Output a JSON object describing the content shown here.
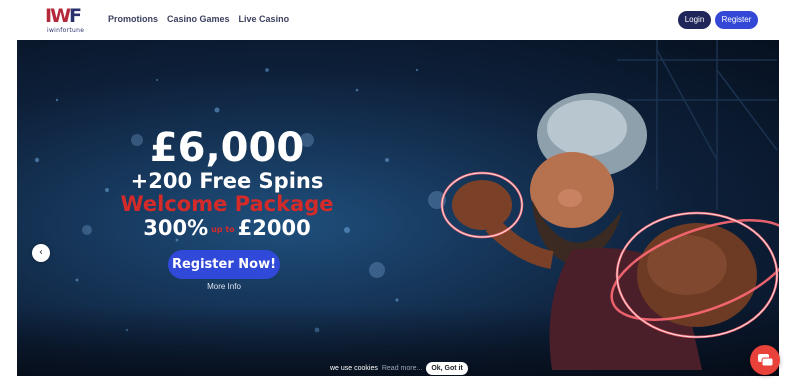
{
  "brand": {
    "logo_text_w": "IW",
    "logo_text_f": "F",
    "logo_subtitle": "iwinfortune"
  },
  "nav": {
    "items": [
      "Promotions",
      "Casino Games",
      "Live Casino"
    ]
  },
  "auth": {
    "login_label": "Login",
    "register_label": "Register"
  },
  "hero": {
    "amount": "£6,000",
    "free_spins": "+200 Free Spins",
    "package": "Welcome Package",
    "percent": "300%",
    "up_to": "up to",
    "max_bonus": "£2000",
    "cta_label": "Register Now!",
    "more_info": "More Info"
  },
  "carousel": {
    "prev_icon": "chevron-left-icon",
    "next_icon": "chevron-right-icon"
  },
  "cookie": {
    "text": "we use cookies",
    "link": "Read more...",
    "ok_label": "Ok, Got it"
  },
  "colors": {
    "accent": "#3149d8",
    "brand_red": "#b5283a",
    "brand_navy": "#202659",
    "hero_red": "#d42a2a"
  }
}
